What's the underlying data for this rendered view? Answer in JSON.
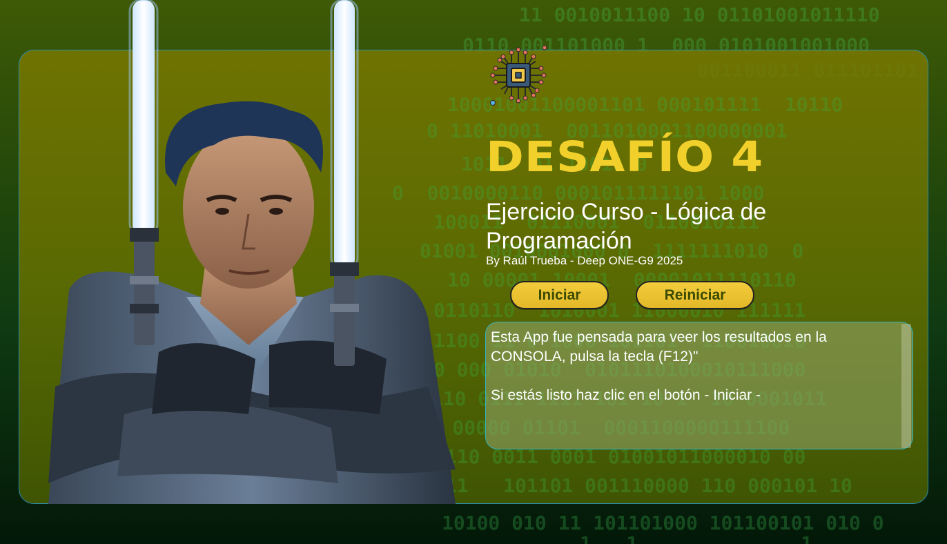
{
  "header": {
    "title": "DESAFÍO 4",
    "subtitle": "Ejercicio Curso - Lógica de Programación",
    "byline": "By Raúl Trueba - Deep ONE-G9 2025"
  },
  "buttons": {
    "start_label": "Iniciar",
    "reset_label": "Reiniciar"
  },
  "message": {
    "line1": "Esta App fue pensada para veer los resultados en la",
    "line2": "CONSOLA, pulsa la tecla (F12)\"",
    "line3": "Si estás listo haz clic en el botón - Iniciar -"
  },
  "icons": {
    "logo": "circuit-chip-icon"
  },
  "colors": {
    "title": "#f2d02c",
    "button": "#e8c232",
    "card_border": "#2b8fb0",
    "binary": "#46c85a"
  }
}
